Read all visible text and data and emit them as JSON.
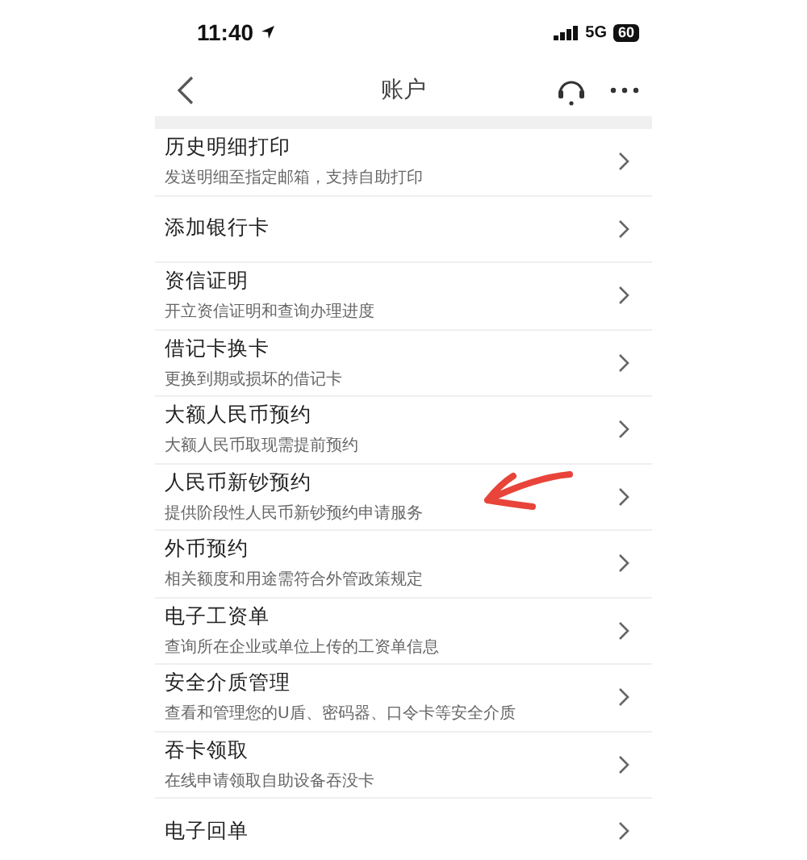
{
  "status_bar": {
    "time": "11:40",
    "network": "5G",
    "battery": "60"
  },
  "nav": {
    "title": "账户"
  },
  "items": [
    {
      "title": "历史明细打印",
      "subtitle": "发送明细至指定邮箱，支持自助打印"
    },
    {
      "title": "添加银行卡"
    },
    {
      "title": "资信证明",
      "subtitle": "开立资信证明和查询办理进度"
    },
    {
      "title": "借记卡换卡",
      "subtitle": "更换到期或损坏的借记卡"
    },
    {
      "title": "大额人民币预约",
      "subtitle": "大额人民币取现需提前预约"
    },
    {
      "title": "人民币新钞预约",
      "subtitle": "提供阶段性人民币新钞预约申请服务"
    },
    {
      "title": "外币预约",
      "subtitle": "相关额度和用途需符合外管政策规定"
    },
    {
      "title": "电子工资单",
      "subtitle": "查询所在企业或单位上传的工资单信息"
    },
    {
      "title": "安全介质管理",
      "subtitle": "查看和管理您的U盾、密码器、口令卡等安全介质"
    },
    {
      "title": "吞卡领取",
      "subtitle": "在线申请领取自助设备吞没卡"
    },
    {
      "title": "电子回单"
    }
  ]
}
